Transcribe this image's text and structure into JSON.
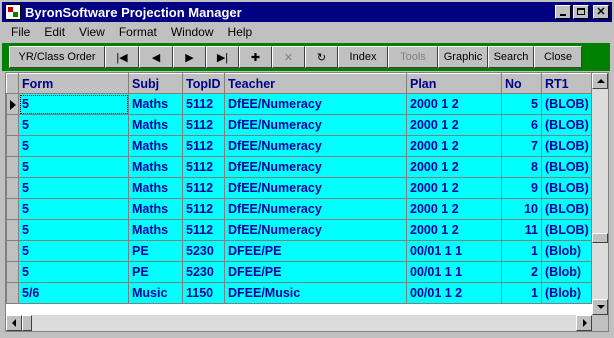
{
  "window": {
    "title": "ByronSoftware Projection Manager",
    "controls": {
      "minimize": "",
      "maximize": "",
      "close": "✕"
    }
  },
  "menu": [
    {
      "label": "File"
    },
    {
      "label": "Edit"
    },
    {
      "label": "View"
    },
    {
      "label": "Format"
    },
    {
      "label": "Window"
    },
    {
      "label": "Help"
    }
  ],
  "toolbar": {
    "yr_class_order": "YR/Class Order",
    "first": "|◀",
    "prev": "◀",
    "next": "▶",
    "last": "▶|",
    "add": "✚",
    "delete": "✕",
    "refresh": "↻",
    "index": "Index",
    "tools": "Tools",
    "graphic": "Graphic",
    "search": "Search",
    "close": "Close"
  },
  "grid": {
    "columns": [
      "Form",
      "Subj",
      "TopID",
      "Teacher",
      "Plan",
      "No",
      "RT1"
    ],
    "rows": [
      [
        "5",
        "Maths",
        "5112",
        "DfEE/Numeracy",
        "2000 1 2",
        "5",
        "(BLOB)"
      ],
      [
        "5",
        "Maths",
        "5112",
        "DfEE/Numeracy",
        "2000 1 2",
        "6",
        "(BLOB)"
      ],
      [
        "5",
        "Maths",
        "5112",
        "DfEE/Numeracy",
        "2000 1 2",
        "7",
        "(BLOB)"
      ],
      [
        "5",
        "Maths",
        "5112",
        "DfEE/Numeracy",
        "2000 1 2",
        "8",
        "(BLOB)"
      ],
      [
        "5",
        "Maths",
        "5112",
        "DfEE/Numeracy",
        "2000 1 2",
        "9",
        "(BLOB)"
      ],
      [
        "5",
        "Maths",
        "5112",
        "DfEE/Numeracy",
        "2000 1 2",
        "10",
        "(BLOB)"
      ],
      [
        "5",
        "Maths",
        "5112",
        "DfEE/Numeracy",
        "2000 1 2",
        "11",
        "(BLOB)"
      ],
      [
        "5",
        "PE",
        "5230",
        "DFEE/PE",
        "00/01 1 1",
        "1",
        "(Blob)"
      ],
      [
        "5",
        "PE",
        "5230",
        "DFEE/PE",
        "00/01 1 1",
        "2",
        "(Blob)"
      ],
      [
        "5/6",
        "Music",
        "1150",
        "DFEE/Music",
        "00/01 1 2",
        "1",
        "(Blob)"
      ]
    ]
  },
  "colors": {
    "title_bar": "#000080",
    "toolbar_bg": "#008000",
    "row_bg": "#00ffff",
    "header_text": "#00008b",
    "cell_text": "#0000a0"
  }
}
